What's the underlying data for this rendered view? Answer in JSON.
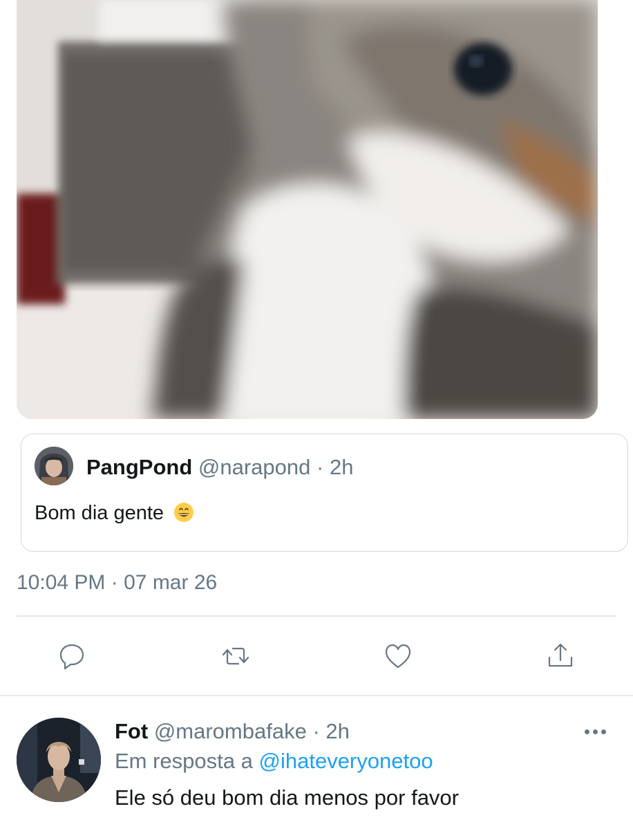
{
  "media": {
    "icon": "cat-photo"
  },
  "quoted_tweet": {
    "display_name": "PangPond",
    "handle": "@narapond",
    "separator": "·",
    "time": "2h",
    "text": "Bom dia gente",
    "emoji": "grinning-face"
  },
  "tweet": {
    "time": "10:04 PM",
    "separator": "·",
    "date": "07 mar 26"
  },
  "actions": [
    "reply-icon",
    "retweet-icon",
    "like-icon",
    "share-icon"
  ],
  "reply": {
    "display_name": "Fot",
    "handle": "@marombafake",
    "separator": "·",
    "time": "2h",
    "replying_prefix": "Em resposta a",
    "replying_to": "@ihateveryonetoo",
    "text": "Ele só deu bom dia menos por favor"
  },
  "colors": {
    "link": "#1da1f2",
    "secondary": "#657786",
    "border": "#cfd9de"
  }
}
